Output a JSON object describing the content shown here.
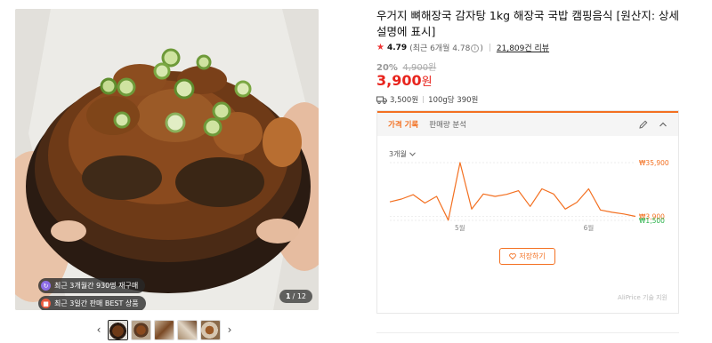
{
  "gallery": {
    "badges": [
      {
        "icon": "repurchase-icon",
        "text": "최근 3개월간 930명 재구매"
      },
      {
        "icon": "best-gift-icon",
        "text": "최근 3일간 판매 BEST 상품"
      }
    ],
    "counter_current": "1",
    "counter_total": "/ 12",
    "thumbnail_count": 5,
    "prev_label": "‹",
    "next_label": "›"
  },
  "product": {
    "title": "우거지 뼈해장국 감자탕 1kg 해장국 국밥 캠핑음식 [원산지: 상세설명에 표시]",
    "rating": "4.79",
    "rating_sub": "(최근 6개월 4.78",
    "rating_sub_end": ")",
    "reviews": "21,809건 리뷰",
    "discount_rate": "20%",
    "original_price": "4,900원",
    "price": "3,900",
    "price_unit": "원",
    "shipping_fee": "3,500원",
    "unit_price": "100g당 390원"
  },
  "price_panel": {
    "tab_active": "가격 기록",
    "tab_inactive": "판매량 분석",
    "period": "3개월",
    "save_label": "저장하기",
    "credit": "AliPrice 기술 지원",
    "accent": "#f37021"
  },
  "chart_data": {
    "type": "line",
    "xlabel_ticks": [
      "5월",
      "6월"
    ],
    "y_labels": [
      {
        "text": "₩35,900",
        "value": 35900,
        "color": "#f37021"
      },
      {
        "text": "₩3,900",
        "value": 3900,
        "color": "#f37021"
      },
      {
        "text": "₩1,500",
        "value": 1500,
        "color": "#2ab24b"
      }
    ],
    "ylim": [
      1500,
      35900
    ],
    "series": [
      {
        "values": [
          12500,
          14200,
          16800,
          11800,
          15800,
          1600,
          35900,
          8200,
          17200,
          15800,
          17000,
          19200,
          9800,
          20300,
          17200,
          8200,
          12300,
          20300,
          7700,
          6300,
          5300,
          3900
        ]
      }
    ]
  }
}
